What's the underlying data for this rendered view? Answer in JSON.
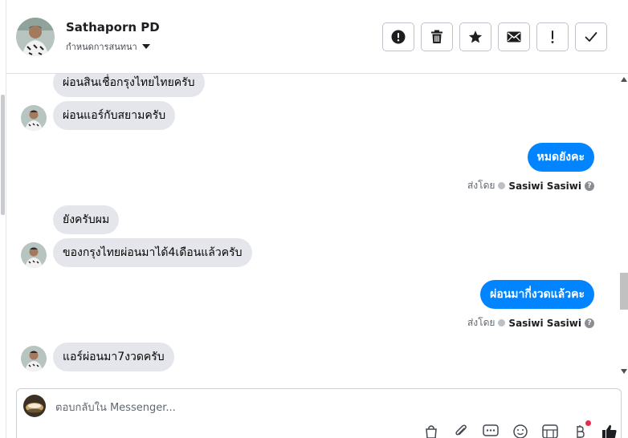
{
  "contact": {
    "name": "Sathaporn PD",
    "assign_label": "กำหนดการสนทนา"
  },
  "actions": [
    {
      "name": "spam-button",
      "icon": "exclamation-circle-icon"
    },
    {
      "name": "delete-button",
      "icon": "trash-icon"
    },
    {
      "name": "star-button",
      "icon": "star-icon"
    },
    {
      "name": "mark-unread-button",
      "icon": "envelope-icon"
    },
    {
      "name": "follow-up-button",
      "icon": "exclamation-icon"
    },
    {
      "name": "mark-done-button",
      "icon": "check-icon"
    }
  ],
  "messages": {
    "m1": "ผ่อนสินเชื่อกรุงไทยไทยครับ",
    "m2": "ผ่อนแอร์กับสยามครับ",
    "m3": "หมดยังคะ",
    "m4": "ยังครับผม",
    "m5": "ของกรุงไทยผ่อนมา​ได้4เดือนแล้วครับ",
    "m6": "ผ่อนมากี่งวดแล้วคะ",
    "m7": "แอร์ผ่อนมา7งวดครับ"
  },
  "sent_by": {
    "label": "ส่งโดย",
    "agent": "Sasiwi Sasiwi"
  },
  "composer": {
    "placeholder": "ตอบกลับใน Messenger..."
  },
  "tools": [
    "bag-icon",
    "paperclip-icon",
    "saved-reply-icon",
    "emoji-icon",
    "sticker-icon",
    "payment-icon",
    "like-icon"
  ],
  "colors": {
    "outgoing": "#0084ff",
    "incoming": "#e4e6eb",
    "notification_dot": "#f02849"
  }
}
